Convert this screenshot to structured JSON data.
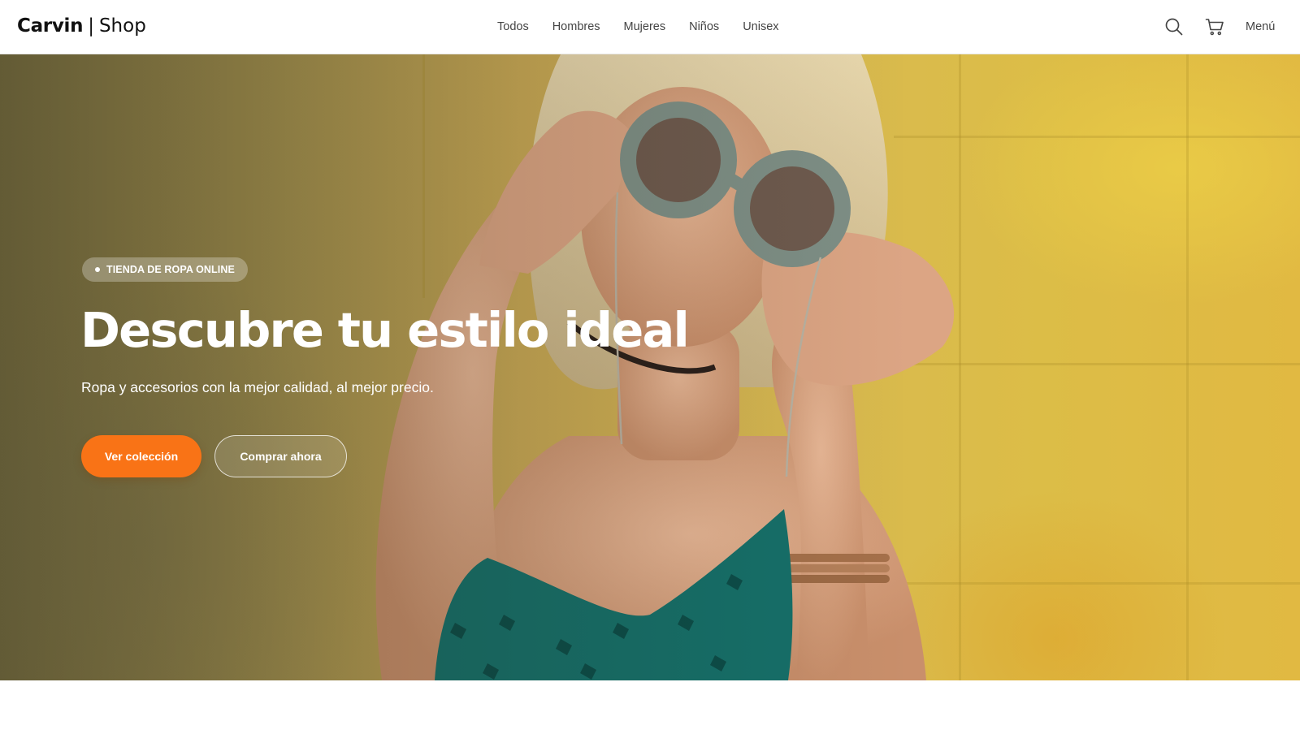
{
  "header": {
    "logo_brand": "Carvin",
    "logo_separator": "|",
    "logo_sub": "Shop",
    "nav": [
      {
        "label": "Todos"
      },
      {
        "label": "Hombres"
      },
      {
        "label": "Mujeres"
      },
      {
        "label": "Niños"
      },
      {
        "label": "Unisex"
      }
    ],
    "search_icon": "search-icon",
    "cart_icon": "cart-icon",
    "menu_label": "Menú"
  },
  "hero": {
    "badge": "TIENDA DE ROPA ONLINE",
    "title": "Descubre tu estilo ideal",
    "subtitle": "Ropa y accesorios con la mejor calidad, al mejor precio.",
    "primary_button": "Ver colección",
    "secondary_button": "Comprar ahora"
  },
  "colors": {
    "accent": "#f97316",
    "text_dark": "#111111",
    "nav_text": "#444444",
    "hero_background": "#d8b950"
  }
}
